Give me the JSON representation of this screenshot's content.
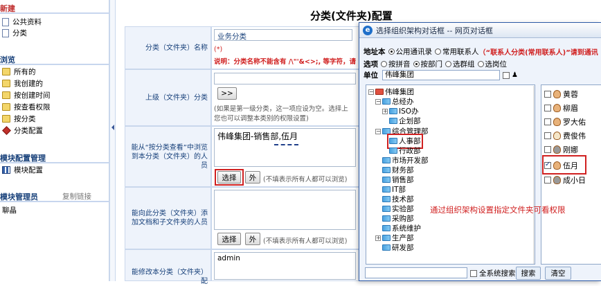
{
  "sidebar": {
    "new_header": "新建",
    "new_items": [
      "公共资料",
      "分类"
    ],
    "browse_header": "浏览",
    "browse_items": [
      "所有的",
      "我创建的",
      "按创建时间",
      "按查看权限",
      "按分类",
      "分类配置"
    ],
    "module_config_header": "模块配置管理",
    "module_config_items": [
      "模块配置"
    ],
    "module_admin_header": "模块管理员",
    "copy_link": "复制链接",
    "admin_name": "聊晶"
  },
  "main": {
    "title": "分类(文件夹)配置",
    "name_label": "分类（文件夹）名称",
    "name_value": "业务分类",
    "required_mark": "(*)",
    "name_note": "说明：分类名称不能含有 /\\\"'&<>;, 等字符，请",
    "parent_label": "上级（文件夹）分类",
    "parent_btn": ">>",
    "parent_hint1": "(如果是第一级分类，这一项应设为空。选择上",
    "parent_hint2": "您也可以调整本类别的权限设置)",
    "viewers_label": "能从“按分类查看”中浏览到本分类（文件夹）的人员",
    "viewers_value": "伟峰集团-销售部,伍月",
    "select_btn": "选择",
    "outside_btn": "外",
    "viewers_hint": "(不填表示所有人都可以浏览)",
    "adders_label": "能向此分类（文件夹）添加文档和子文件夹的人员",
    "adders_hint": "(不填表示所有人都可以浏览)",
    "modifiers_label": "能修改本分类（文件夹）配",
    "modifiers_value": "admin"
  },
  "dialog": {
    "title": "选择组织架构对话框 -- 网页对话框",
    "address_label": "地址本",
    "radio_public": "公用通讯录",
    "radio_contacts": "常用联系人",
    "contacts_note": "（“联系人分类(常用联系人)”请到通讯",
    "options_label": "选项",
    "opt_pinyin": "按拼音",
    "opt_dept": "按部门",
    "opt_group": "选群组",
    "opt_post": "选岗位",
    "unit_label": "单位",
    "unit_value": "伟峰集团",
    "tree": {
      "root": "伟峰集团",
      "nodes": [
        "总经办",
        "ISO办",
        "企划部",
        "综合管理部",
        "人事部",
        "行政部",
        "市场开发部",
        "财务部",
        "销售部",
        "IT部",
        "技术部",
        "实验部",
        "采购部",
        "系统维护",
        "生产部",
        "研发部"
      ]
    },
    "people": [
      "黄蓉",
      "柳眉",
      "罗大佑",
      "费俊伟",
      "刚娜",
      "伍月",
      "成小日"
    ],
    "checked_person": "伍月",
    "global_search": "全系统搜索",
    "search_btn": "搜索",
    "clear_btn": "清空",
    "annotation": "通过组织架构设置指定文件夹可看权限"
  }
}
